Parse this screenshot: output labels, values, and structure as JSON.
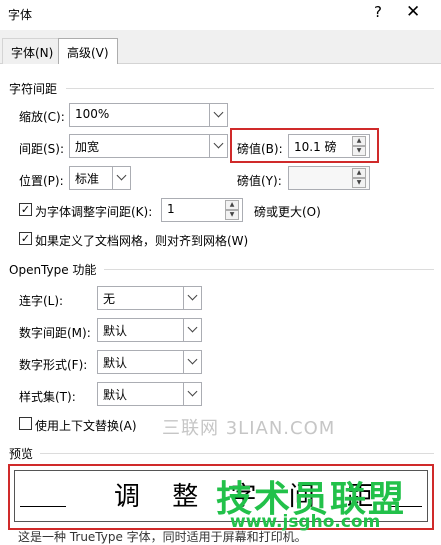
{
  "window": {
    "title": "字体",
    "help_glyph": "?",
    "close_glyph": "✕"
  },
  "tabs": [
    {
      "label": "字体(N)"
    },
    {
      "label": "高级(V)"
    }
  ],
  "char_spacing": {
    "heading": "字符间距",
    "scale_label": "缩放(C):",
    "scale_value": "100%",
    "spacing_label": "间距(S):",
    "spacing_value": "加宽",
    "spacing_by_label": "磅值(B):",
    "spacing_by_value": "10.1 磅",
    "position_label": "位置(P):",
    "position_value": "标准",
    "position_by_label": "磅值(Y):",
    "position_by_value": "",
    "kerning_label": "为字体调整字间距(K):",
    "kerning_checked": true,
    "kerning_value": "1",
    "kerning_suffix": "磅或更大(O)",
    "grid_label": "如果定义了文档网格，则对齐到网格(W)",
    "grid_checked": true
  },
  "opentype": {
    "heading": "OpenType 功能",
    "ligatures_label": "连字(L):",
    "ligatures_value": "无",
    "numspacing_label": "数字间距(M):",
    "numspacing_value": "默认",
    "numforms_label": "数字形式(F):",
    "numforms_value": "默认",
    "stylistic_label": "样式集(T):",
    "stylistic_value": "默认",
    "contextual_label": "使用上下文替换(A)",
    "contextual_checked": false
  },
  "preview": {
    "heading": "预览",
    "sample_text": "调 整 字 间 距",
    "note": "这是一种 TrueType 字体，同时适用于屏幕和打印机。"
  },
  "watermarks": {
    "top": "三联网 3LIAN.COM",
    "logo": "技术员联盟",
    "url": "www.jsgho.com"
  },
  "colors": {
    "highlight": "#d02a2a",
    "watermark_green": "#22c14a"
  }
}
